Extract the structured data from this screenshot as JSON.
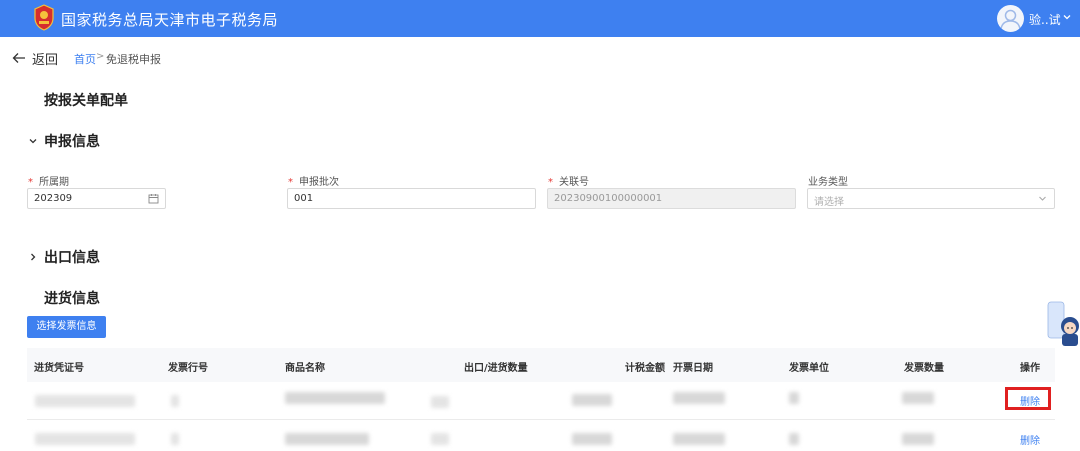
{
  "header": {
    "title": "国家税务总局天津市电子税务局",
    "user_name": "验..试",
    "logo_icon": "tax-emblem-icon",
    "accent": "#3e80f0"
  },
  "nav": {
    "back_label": "返回",
    "breadcrumb_home": "首页",
    "breadcrumb_separator": ">",
    "breadcrumb_current": "免退税申报"
  },
  "page": {
    "title": "按报关单配单"
  },
  "sections": {
    "declare_info": "申报信息",
    "export_info": "出口信息",
    "purchase_info": "进货信息"
  },
  "form": {
    "period": {
      "label": "所属期",
      "required": true,
      "value": "202309"
    },
    "batch": {
      "label": "申报批次",
      "required": true,
      "value": "001"
    },
    "link_no": {
      "label": "关联号",
      "required": true,
      "value": "20230900100000001"
    },
    "biz_type": {
      "label": "业务类型",
      "required": false,
      "placeholder": "请选择"
    }
  },
  "actions": {
    "select_invoice_label": "选择发票信息"
  },
  "table": {
    "columns": [
      "进货凭证号",
      "发票行号",
      "商品名称",
      "出口/进货数量",
      "计税金额",
      "开票日期",
      "发票单位",
      "发票数量",
      "操作"
    ],
    "rows": [
      {
        "delete_label": "删除",
        "highlighted": true
      },
      {
        "delete_label": "删除",
        "highlighted": false
      }
    ]
  }
}
